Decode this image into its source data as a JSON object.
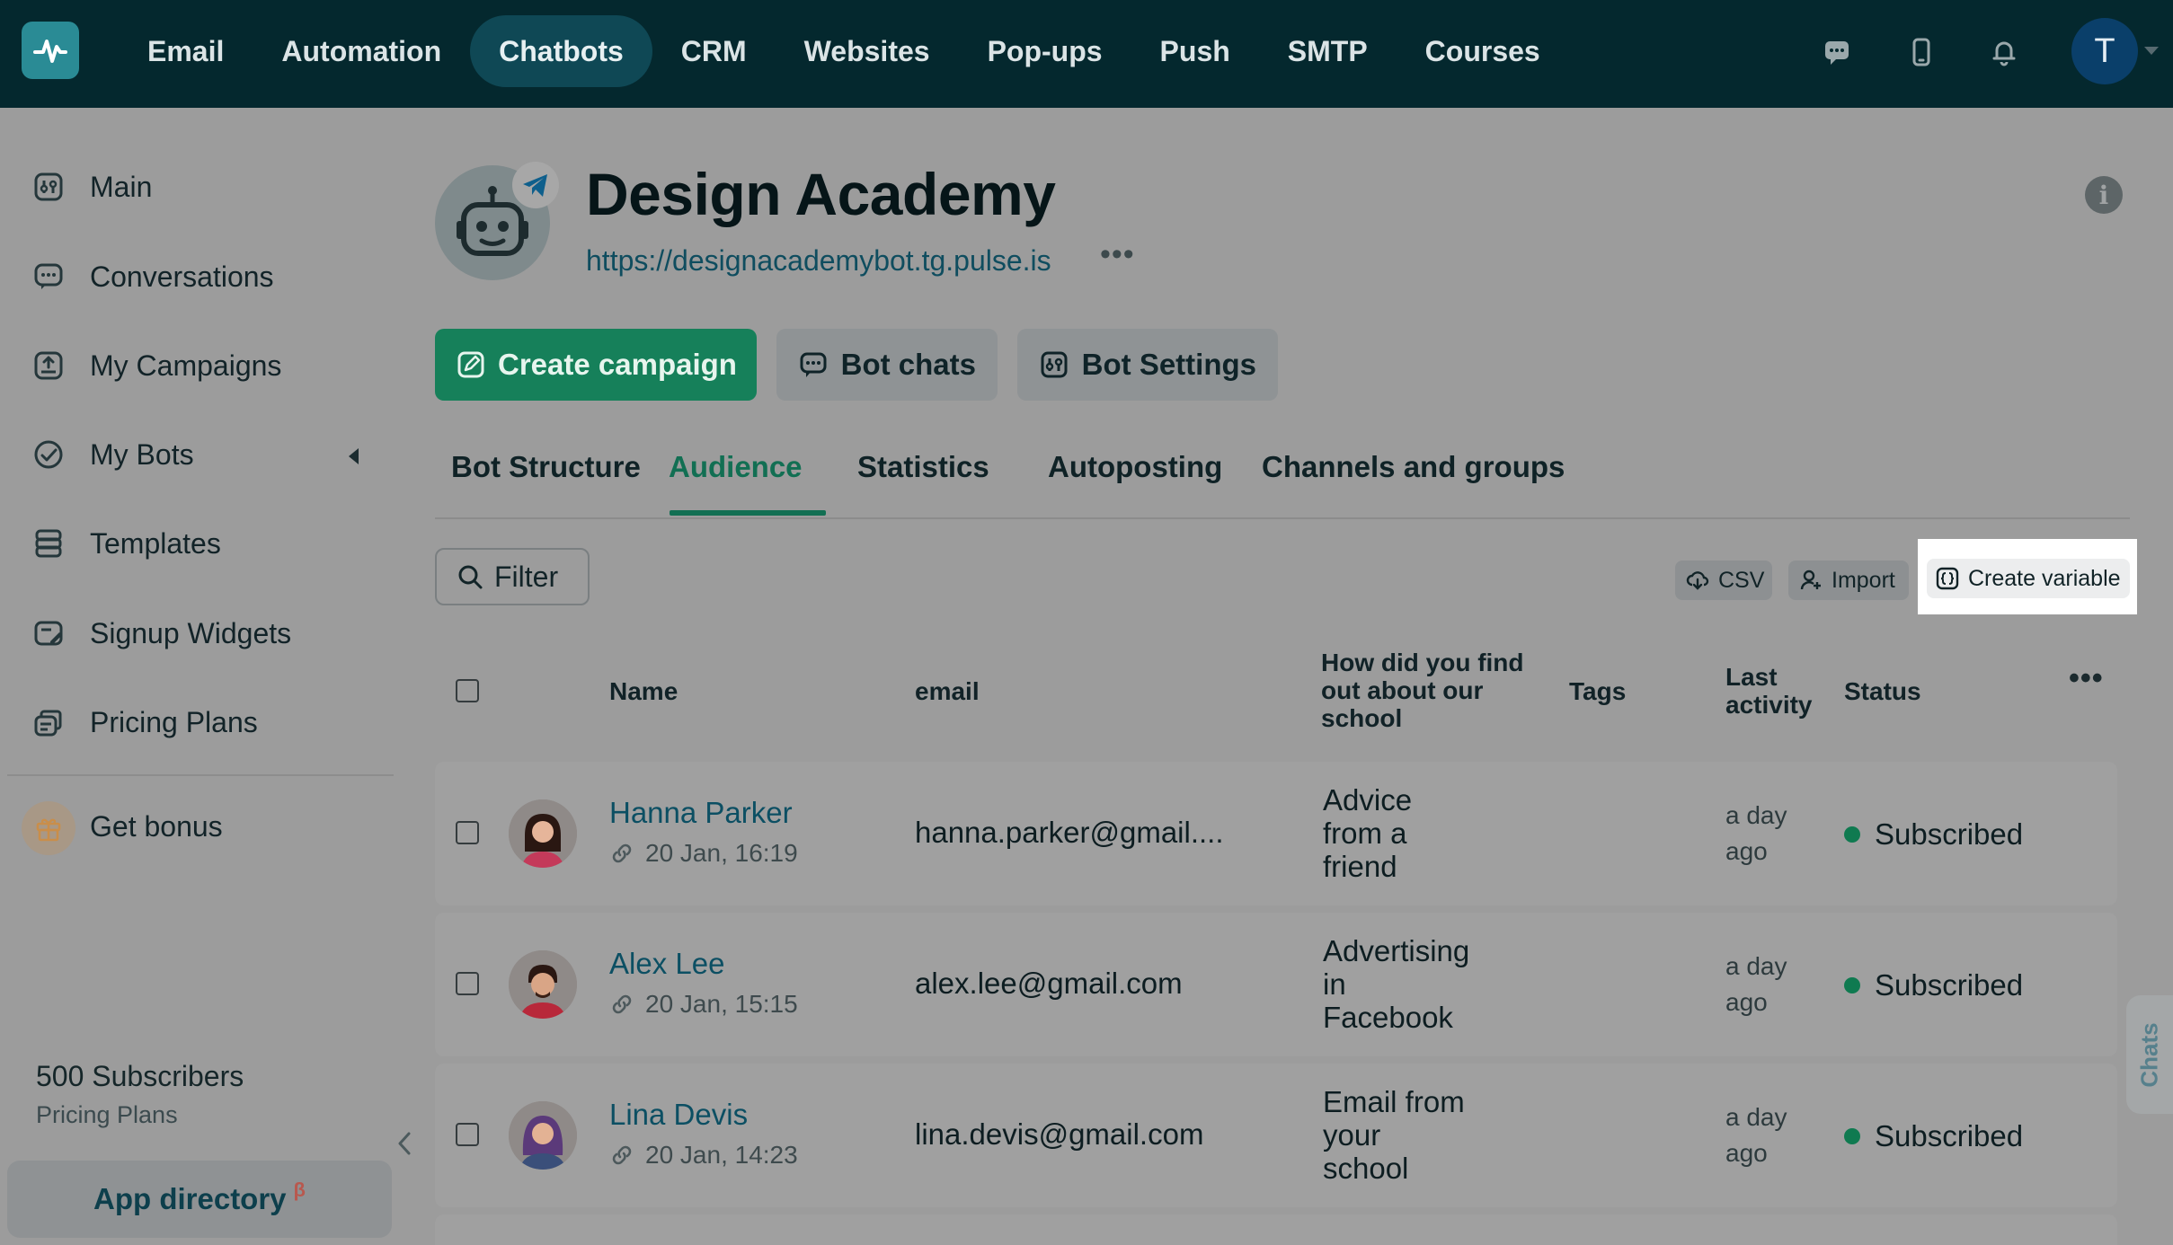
{
  "nav": {
    "items": [
      "Email",
      "Automation",
      "Chatbots",
      "CRM",
      "Websites",
      "Pop-ups",
      "Push",
      "SMTP",
      "Courses"
    ],
    "active": "Chatbots",
    "user_initial": "T"
  },
  "sidebar": {
    "items": [
      {
        "label": "Main",
        "icon": "main-icon"
      },
      {
        "label": "Conversations",
        "icon": "conversations-icon"
      },
      {
        "label": "My Campaigns",
        "icon": "campaigns-icon"
      },
      {
        "label": "My Bots",
        "icon": "bots-icon"
      },
      {
        "label": "Templates",
        "icon": "templates-icon"
      },
      {
        "label": "Signup Widgets",
        "icon": "widgets-icon"
      },
      {
        "label": "Pricing Plans",
        "icon": "pricing-icon"
      }
    ],
    "bonus_label": "Get bonus",
    "subscribers": "500 Subscribers",
    "pricing_link": "Pricing Plans",
    "app_directory": "App directory",
    "beta_mark": "β"
  },
  "bot": {
    "title": "Design Academy",
    "url": "https://designacademybot.tg.pulse.is"
  },
  "actions": {
    "create_campaign": "Create campaign",
    "bot_chats": "Bot chats",
    "bot_settings": "Bot Settings"
  },
  "tabs": [
    "Bot Structure",
    "Audience",
    "Statistics",
    "Autoposting",
    "Channels and groups"
  ],
  "active_tab": "Audience",
  "toolbar": {
    "filter": "Filter",
    "csv": "CSV",
    "import": "Import",
    "create_variable": "Create variable"
  },
  "table": {
    "columns": {
      "name": "Name",
      "email": "email",
      "source_line1": "How did you find",
      "source_line2": "out about our",
      "source_line3": "school",
      "tags": "Tags",
      "last_line1": "Last",
      "last_line2": "activity",
      "status": "Status"
    },
    "rows": [
      {
        "name": "Hanna Parker",
        "date": "20 Jan, 16:19",
        "email": "hanna.parker@gmail....",
        "source": [
          "Advice",
          "from a",
          "friend"
        ],
        "last": [
          "a day",
          "ago"
        ],
        "status": "Subscribed"
      },
      {
        "name": "Alex Lee",
        "date": "20 Jan, 15:15",
        "email": "alex.lee@gmail.com",
        "source": [
          "Advertising",
          "in",
          "Facebook"
        ],
        "last": [
          "a day",
          "ago"
        ],
        "status": "Subscribed"
      },
      {
        "name": "Lina Devis",
        "date": "20 Jan, 14:23",
        "email": "lina.devis@gmail.com",
        "source": [
          "Email from",
          "your",
          "school"
        ],
        "last": [
          "a day",
          "ago"
        ],
        "status": "Subscribed"
      }
    ]
  },
  "chats_tab": "Chats",
  "colors": {
    "nav_bg": "#04282e",
    "primary": "#16805a",
    "link": "#0c4f63",
    "status_dot": "#0f7a50"
  }
}
